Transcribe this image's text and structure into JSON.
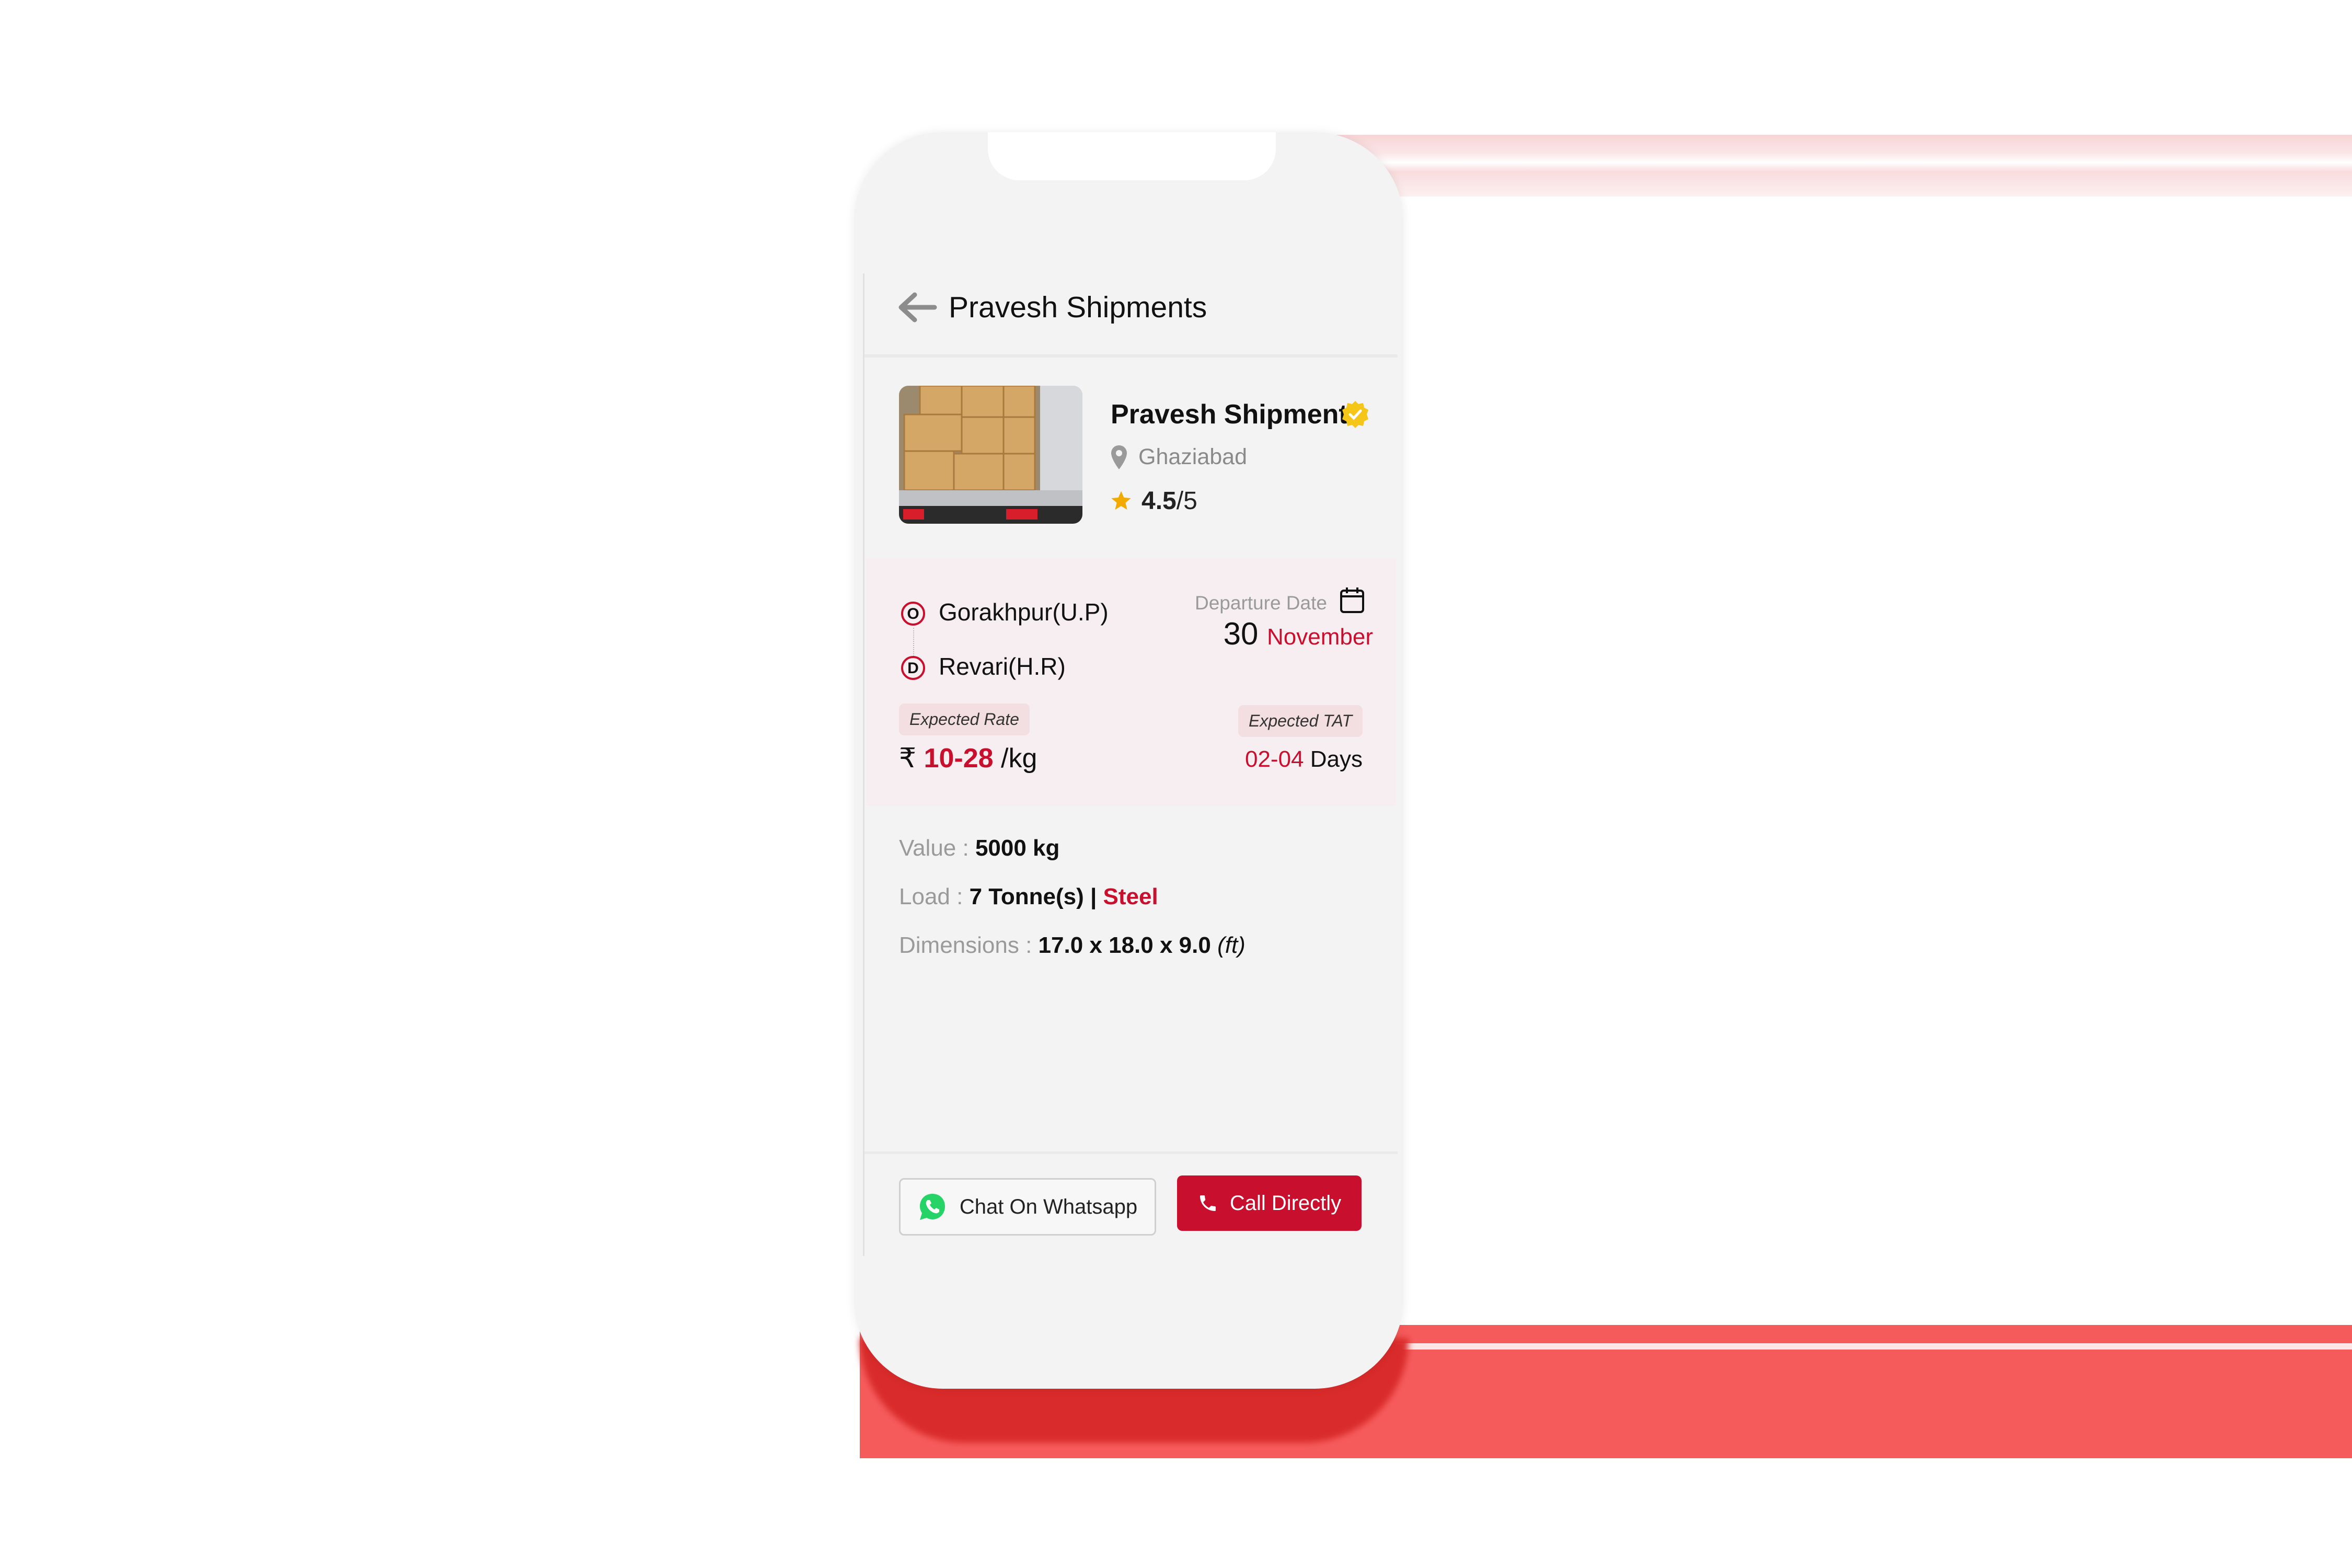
{
  "colors": {
    "accent": "#c8102e",
    "verified": "#f5c518",
    "whatsapp": "#25d366",
    "section_bg": "#f6eef0"
  },
  "header": {
    "back_icon": "arrow-left-icon",
    "title": "Pravesh Shipments"
  },
  "profile": {
    "name": "Pravesh Shipments",
    "verified_icon": "verified-badge-icon",
    "location": "Ghaziabad",
    "rating": "4.5",
    "rating_max": "/5"
  },
  "route": {
    "origin_marker": "O",
    "origin": "Gorakhpur(U.P)",
    "destination_marker": "D",
    "destination": "Revari(H.R)",
    "departure_label": "Departure Date",
    "departure_day": "30",
    "departure_month": "November"
  },
  "rate": {
    "label": "Expected Rate",
    "currency": "₹",
    "value": "10-28",
    "unit": "/kg"
  },
  "tat": {
    "label": "Expected TAT",
    "value": "02-04",
    "unit": "Days"
  },
  "details": {
    "value_label": "Value : ",
    "value": "5000 kg",
    "load_label": "Load : ",
    "load": "7 Tonne(s) | ",
    "material": "Steel",
    "dimensions_label": "Dimensions : ",
    "dimensions": "17.0 x 18.0 x 9.0",
    "dimensions_unit": "(ft)"
  },
  "actions": {
    "whatsapp": "Chat On Whatsapp",
    "call": "Call Directly"
  }
}
